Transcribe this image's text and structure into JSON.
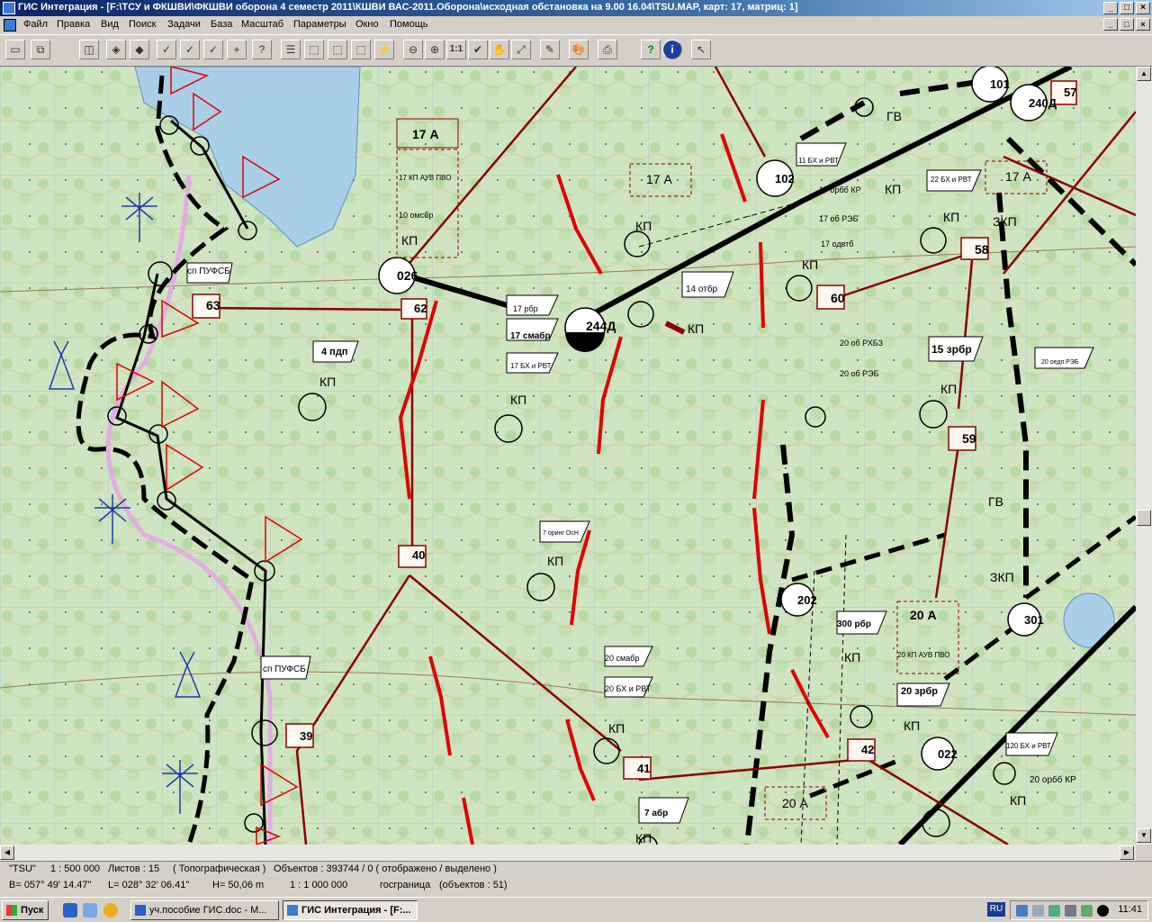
{
  "window": {
    "title": "ГИС Интеграция - [F:\\ТСУ и ФКШВИ\\ФКШВИ оборона 4 семестр 2011\\КШВИ ВАС-2011.Оборона\\исходная обстановка на 9.00  16.04\\TSU.MAP, карт: 17, матриц: 1]",
    "minimize": "_",
    "maximize": "□",
    "close": "×"
  },
  "menu": [
    "Файл",
    "Правка",
    "Вид",
    "Поиск",
    "Задачи",
    "База",
    "Масштаб",
    "Параметры",
    "Окно",
    "Помощь"
  ],
  "toolbar": {
    "icons": [
      "open-icon",
      "new-window-icon",
      "layers-icon",
      "pick-icon",
      "pick-all-icon",
      "pick-object-icon",
      "pick-add-icon",
      "pick-query-icon",
      "list-icon",
      "select-frame-icon",
      "select-all-icon",
      "select-zoom-icon",
      "lightning-icon",
      "zoom-in-icon",
      "zoom-out-icon",
      "scale-1-1-icon",
      "check-icon",
      "pan-hand-icon",
      "zoom-fit-icon",
      "edit-icon",
      "palette-icon",
      "print-icon",
      "help-icon",
      "info-icon",
      "pointer-help-icon"
    ],
    "scale_label": "1:1"
  },
  "map": {
    "unit_labels": [
      "17 А",
      "17 КП АУВ ПВО",
      "10 омсбр",
      "КП",
      "026",
      "62",
      "63",
      "сп ПУФСБ",
      "4 пдп",
      "КП",
      "17 рбр",
      "17 смабр",
      "17 БХ и РВТ",
      "КП",
      "244Д",
      "17 А",
      "КП",
      "14 отбр",
      "КП",
      "102",
      "11 БХ и РВТ",
      "17 орбб КР",
      "17 об РЭБ",
      "17 одвтб",
      "КП",
      "60",
      "ГВ",
      "КП",
      "22 БХ и РВТ",
      "КП",
      "ЗКП",
      "58",
      "101",
      "240Д",
      "57",
      "17 А",
      "20 об РХБЗ",
      "20 об РЭБ",
      "15 зрбр",
      "КП",
      "59",
      "20 оедп РЭБ",
      "ГВ",
      "ЗКП",
      "7 оринг ОсН",
      "КП",
      "40",
      "202",
      "300 рбр",
      "КП",
      "20 А",
      "20 КП АУВ ПВО",
      "20 зрбр",
      "КП",
      "301",
      "сп ПУФСБ",
      "39",
      "20 смабр",
      "20 БХ и РВТ",
      "КП",
      "41",
      "42",
      "022",
      "120 БХ и РВТ",
      "20 орбб КР",
      "КП",
      "20 А",
      "7 абр",
      "КП"
    ]
  },
  "status": {
    "line1": {
      "map_name": "\"TSU\"",
      "scale": "1 : 500 000",
      "sheets": "Листов : 15",
      "type": "( Топографическая )",
      "objects": "Объектов : 393744 / 0 ( отображено / выделено )"
    },
    "line2": {
      "b": "B= 057° 49' 14.47\"",
      "l": "L= 028° 32' 06.41\"",
      "h": "H= 50,06 m",
      "scale": "1 : 1 000 000",
      "layer": "госграница",
      "count": "(объектов : 51)"
    }
  },
  "taskbar": {
    "start_label": "Пуск",
    "tasks": [
      {
        "label": "уч.пособие ГИС.doc - M...",
        "active": false
      },
      {
        "label": "ГИС Интеграция - [F:...",
        "active": true
      }
    ],
    "lang": "RU",
    "time": "11:41"
  }
}
